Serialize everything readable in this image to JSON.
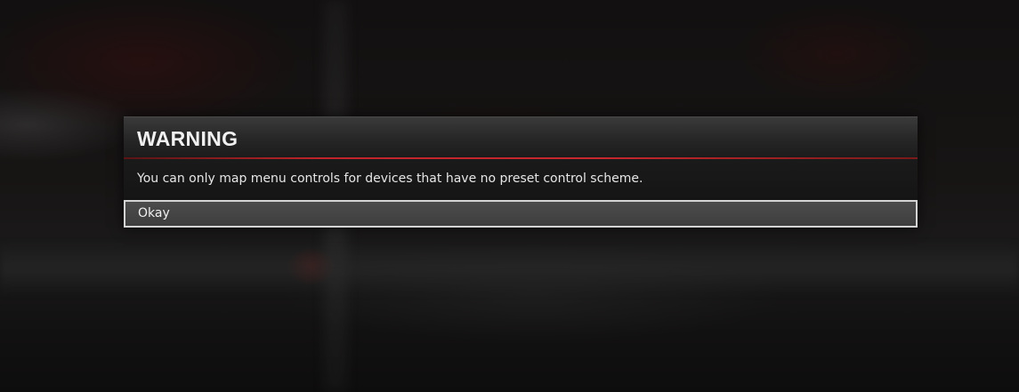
{
  "dialog": {
    "title": "WARNING",
    "message": "You can only map menu controls for devices that have no preset control scheme.",
    "buttons": {
      "okay_label": "Okay"
    }
  },
  "colors": {
    "accent_red": "#c8272d",
    "button_border": "#d4d4d4",
    "text": "#f1f1f1"
  }
}
